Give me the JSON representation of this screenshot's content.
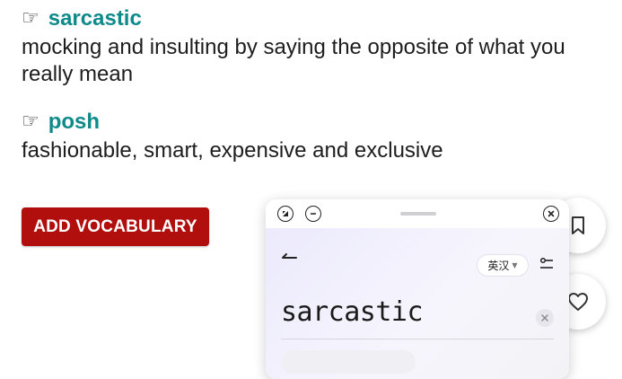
{
  "entries": [
    {
      "pointer": "☞",
      "word": "sarcastic",
      "definition": "mocking and insulting by saying the opposite of what you really mean"
    },
    {
      "pointer": "☞",
      "word": "posh",
      "definition": "fashionable, smart, expensive and exclusive"
    }
  ],
  "actions": {
    "add_vocabulary_label": "ADD VOCABULARY"
  },
  "popup": {
    "language_label": "英汉",
    "search_value": "sarcastic"
  },
  "colors": {
    "word": "#0f8a8a",
    "button": "#b10e0e"
  },
  "icons": {
    "side_buttons": [
      "bookmark-icon",
      "heart-icon"
    ],
    "popup": [
      "collapse-icon",
      "minimize-icon",
      "close-icon",
      "back-arrow-icon",
      "settings-icon",
      "clear-icon"
    ]
  }
}
